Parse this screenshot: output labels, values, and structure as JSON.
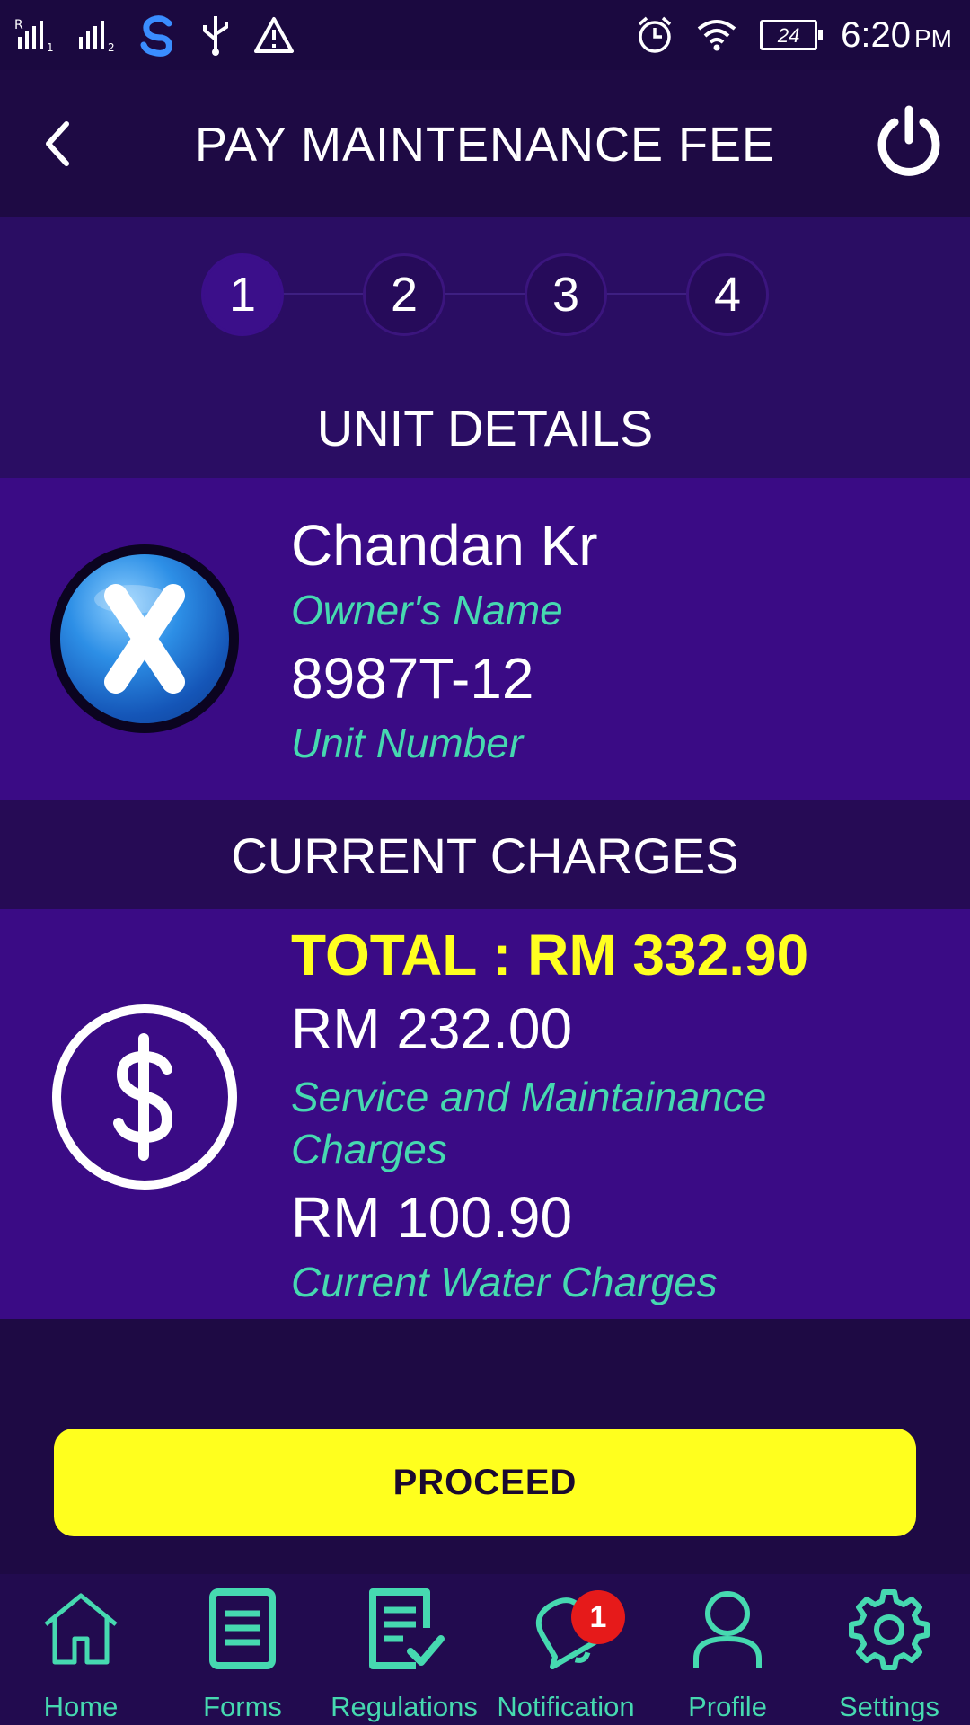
{
  "status_bar": {
    "time": "6:20",
    "ampm": "PM",
    "battery": "24"
  },
  "header": {
    "title": "PAY MAINTENANCE FEE"
  },
  "stepper": {
    "steps": [
      "1",
      "2",
      "3",
      "4"
    ],
    "active_step": 1
  },
  "unit_details": {
    "section_title": "UNIT DETAILS",
    "owner_name": "Chandan Kr",
    "owner_name_label": "Owner's Name",
    "unit_number": "8987T-12",
    "unit_number_label": "Unit Number"
  },
  "current_charges": {
    "section_title": "CURRENT CHARGES",
    "total": "TOTAL : RM 332.90",
    "service_amount": "RM 232.00",
    "service_label": "Service and Maintainance Charges",
    "water_amount": "RM 100.90",
    "water_label": "Current Water Charges"
  },
  "actions": {
    "proceed_label": "PROCEED"
  },
  "bottom_nav": {
    "items": [
      {
        "label": "Home",
        "icon": "home-icon"
      },
      {
        "label": "Forms",
        "icon": "forms-icon"
      },
      {
        "label": "Regulations",
        "icon": "regulations-icon"
      },
      {
        "label": "Notification",
        "icon": "bell-icon",
        "badge": "1"
      },
      {
        "label": "Profile",
        "icon": "profile-icon"
      },
      {
        "label": "Settings",
        "icon": "gear-icon"
      }
    ]
  },
  "colors": {
    "background": "#1e0a44",
    "card": "#3a0b85",
    "accent_teal": "#46d9b0",
    "accent_yellow": "#ffff1e",
    "badge_red": "#e61a1a"
  }
}
